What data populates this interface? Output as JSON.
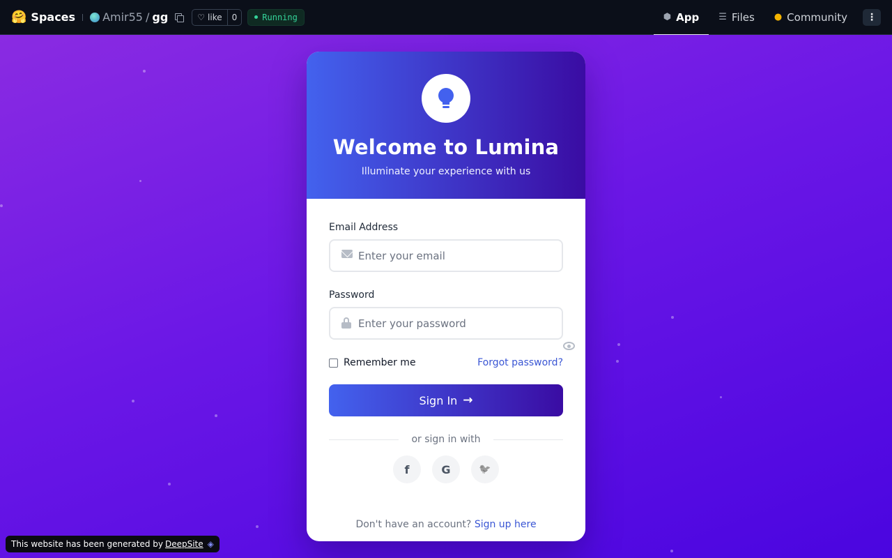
{
  "topbar": {
    "brand_emoji": "🤗",
    "brand_label": "Spaces",
    "repo_owner": "Amir55",
    "repo_slash": "/",
    "repo_name": "gg",
    "like_label": "like",
    "like_count": "0",
    "status": "Running",
    "nav": [
      {
        "label": "App",
        "icon": "cube-icon",
        "active": true
      },
      {
        "label": "Files",
        "icon": "files-icon",
        "active": false
      },
      {
        "label": "Community",
        "icon": "community-icon",
        "active": false
      }
    ],
    "menu_glyph": "⋮"
  },
  "card": {
    "title": "Welcome to Lumina",
    "subtitle": "Illuminate your experience with us",
    "email_label": "Email Address",
    "email_placeholder": "Enter your email",
    "password_label": "Password",
    "password_placeholder": "Enter your password",
    "remember_label": "Remember me",
    "remember_checked": false,
    "forgot_label": "Forgot password?",
    "signin_label": "Sign In",
    "divider_label": "or sign in with",
    "socials": [
      {
        "glyph": "f",
        "icon": "facebook-icon"
      },
      {
        "glyph": "G",
        "icon": "google-icon"
      },
      {
        "glyph": "🐦",
        "icon": "twitter-icon"
      }
    ],
    "signup_prompt": "Don't have an account?",
    "signup_link": "Sign up here"
  },
  "badge": {
    "text": "This website has been generated by",
    "link": "DeepSite"
  },
  "colors": {
    "primary": "#4361ee",
    "secondary": "#3a0ca3",
    "link": "#3a56d4",
    "running": "#34d399"
  }
}
